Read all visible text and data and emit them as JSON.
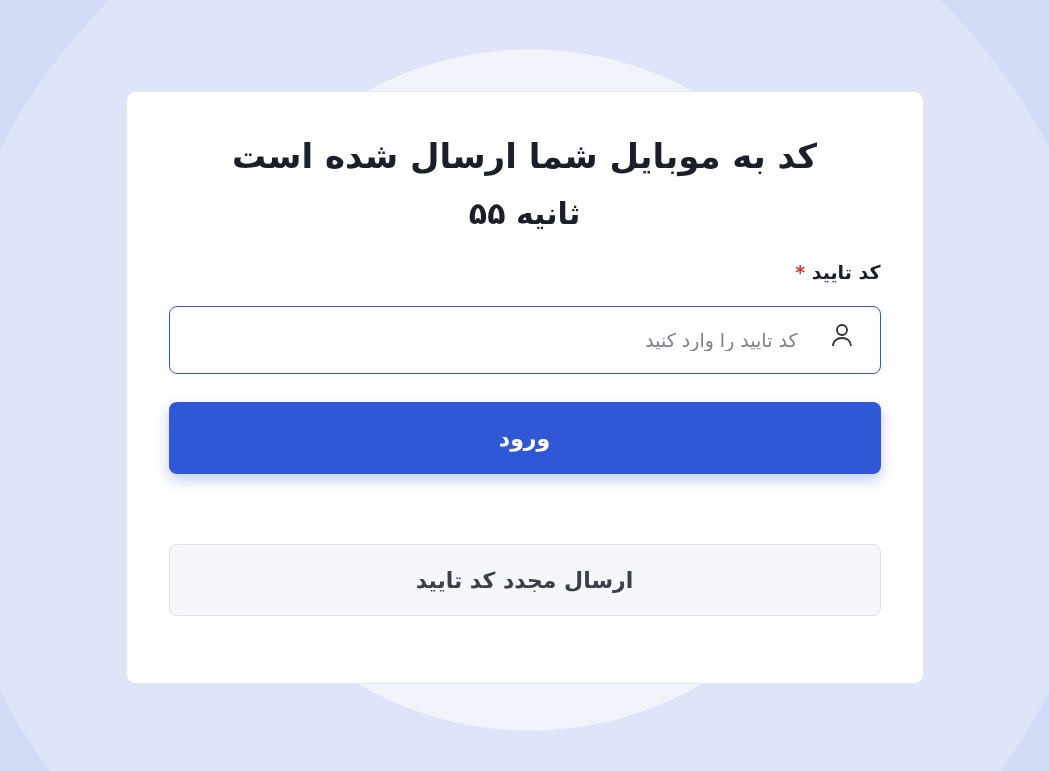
{
  "title": "کد به موبایل شما ارسال شده است",
  "timer": "ثانیه ۵۵",
  "code_field": {
    "label": "کد تایید",
    "required_mark": "*",
    "placeholder": "کد تایید را وارد کنید",
    "focused": true
  },
  "buttons": [
    {
      "kind": "primary",
      "label": "ورود"
    },
    {
      "kind": "secondary",
      "label": "ارسال مجدد کد تایید"
    }
  ]
}
